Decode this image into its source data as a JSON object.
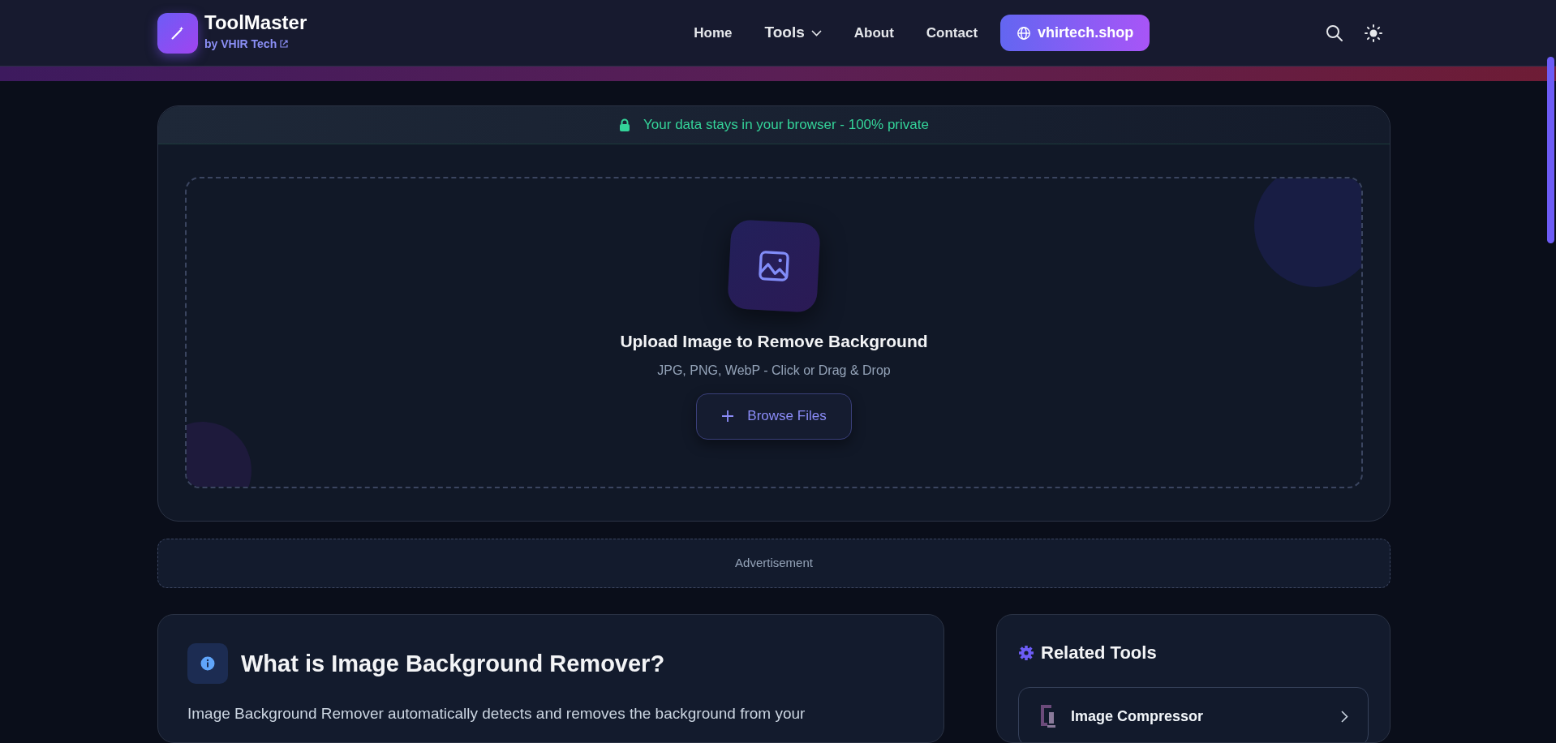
{
  "navbar": {
    "brand": "ToolMaster",
    "byline": "by VHIR Tech",
    "links": [
      {
        "label": "Home",
        "kind": "link"
      },
      {
        "label": "Tools",
        "kind": "dropdown"
      },
      {
        "label": "About",
        "kind": "link"
      },
      {
        "label": "Contact",
        "kind": "link"
      }
    ],
    "site_button": "vhirtech.shop"
  },
  "privacy_banner": "Your data stays in your browser - 100% private",
  "upload": {
    "title": "Upload Image to Remove Background",
    "formats": "JPG, PNG, WebP - Click or Drag & Drop",
    "button": "Browse Files"
  },
  "advertisement": "Advertisement",
  "about": {
    "title": "What is Image Background Remover?",
    "paragraph": "Image Background Remover automatically detects and removes the background from your"
  },
  "related_tools": {
    "title": "Related Tools",
    "items": [
      {
        "label": "Image Compressor"
      }
    ]
  }
}
